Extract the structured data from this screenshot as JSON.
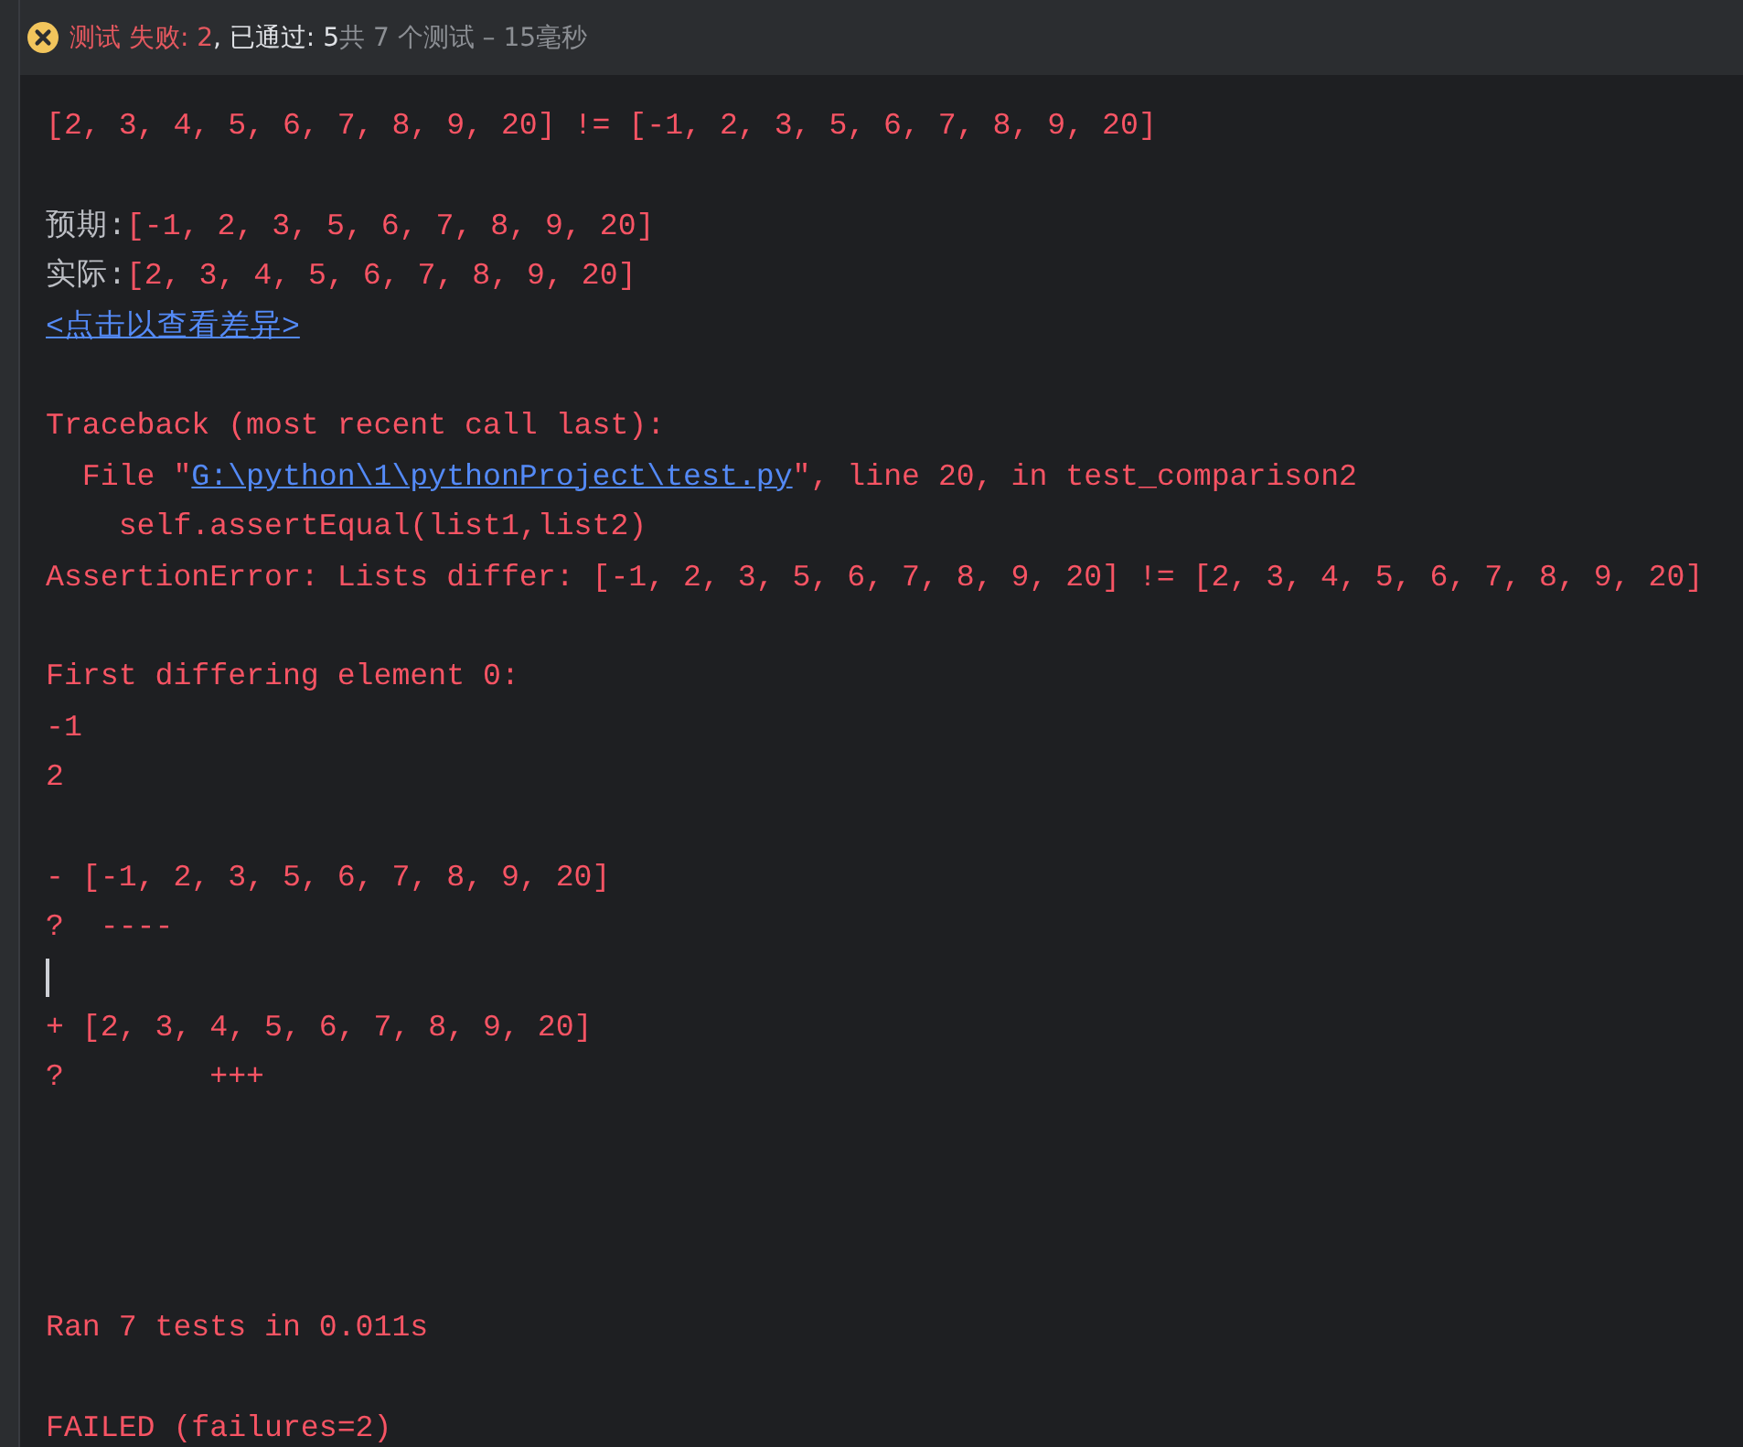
{
  "header": {
    "failed": true,
    "segments": [
      {
        "kind": "fail",
        "text": "测试 失败: 2"
      },
      {
        "kind": "info",
        "text": ", 已通过: 5"
      },
      {
        "kind": "muted",
        "text": "共 7 个测试 – 15毫秒"
      }
    ]
  },
  "console": [
    {
      "kind": "text",
      "segments": [
        {
          "kind": "error",
          "text": "[2, 3, 4, 5, 6, 7, 8, 9, 20] != [-1, 2, 3, 5, 6, 7, 8, 9, 20]"
        }
      ]
    },
    {
      "kind": "blank"
    },
    {
      "kind": "text",
      "segments": [
        {
          "kind": "info",
          "text": "预期:"
        },
        {
          "kind": "error",
          "text": "[-1, 2, 3, 5, 6, 7, 8, 9, 20]"
        }
      ]
    },
    {
      "kind": "text",
      "segments": [
        {
          "kind": "info",
          "text": "实际:"
        },
        {
          "kind": "error",
          "text": "[2, 3, 4, 5, 6, 7, 8, 9, 20]"
        }
      ]
    },
    {
      "kind": "text",
      "segments": [
        {
          "kind": "link",
          "text": "<点击以查看差异>"
        }
      ]
    },
    {
      "kind": "blank"
    },
    {
      "kind": "text",
      "segments": [
        {
          "kind": "error",
          "text": "Traceback (most recent call last):"
        }
      ]
    },
    {
      "kind": "text",
      "segments": [
        {
          "kind": "error",
          "text": "  File \""
        },
        {
          "kind": "link",
          "text": "G:\\python\\1\\pythonProject\\test.py"
        },
        {
          "kind": "error",
          "text": "\", line 20, in test_comparison2"
        }
      ]
    },
    {
      "kind": "text",
      "segments": [
        {
          "kind": "error",
          "text": "    self.assertEqual(list1,list2)"
        }
      ]
    },
    {
      "kind": "text",
      "segments": [
        {
          "kind": "error",
          "text": "AssertionError: Lists differ: [-1, 2, 3, 5, 6, 7, 8, 9, 20] != [2, 3, 4, 5, 6, 7, 8, 9, 20]"
        }
      ]
    },
    {
      "kind": "blank"
    },
    {
      "kind": "text",
      "segments": [
        {
          "kind": "error",
          "text": "First differing element 0:"
        }
      ]
    },
    {
      "kind": "text",
      "segments": [
        {
          "kind": "error",
          "text": "-1"
        }
      ]
    },
    {
      "kind": "text",
      "segments": [
        {
          "kind": "error",
          "text": "2"
        }
      ]
    },
    {
      "kind": "blank"
    },
    {
      "kind": "text",
      "segments": [
        {
          "kind": "error",
          "text": "- [-1, 2, 3, 5, 6, 7, 8, 9, 20]"
        }
      ]
    },
    {
      "kind": "text",
      "segments": [
        {
          "kind": "error",
          "text": "?  ----"
        }
      ]
    },
    {
      "kind": "cursor"
    },
    {
      "kind": "text",
      "segments": [
        {
          "kind": "error",
          "text": "+ [2, 3, 4, 5, 6, 7, 8, 9, 20]"
        }
      ]
    },
    {
      "kind": "text",
      "segments": [
        {
          "kind": "error",
          "text": "?        +++"
        }
      ]
    },
    {
      "kind": "blank"
    },
    {
      "kind": "blank"
    },
    {
      "kind": "blank"
    },
    {
      "kind": "blank"
    },
    {
      "kind": "text",
      "segments": [
        {
          "kind": "error",
          "text": "Ran 7 tests in 0.011s"
        }
      ]
    },
    {
      "kind": "blank"
    },
    {
      "kind": "text",
      "segments": [
        {
          "kind": "error",
          "text": "FAILED (failures=2)"
        }
      ]
    }
  ]
}
